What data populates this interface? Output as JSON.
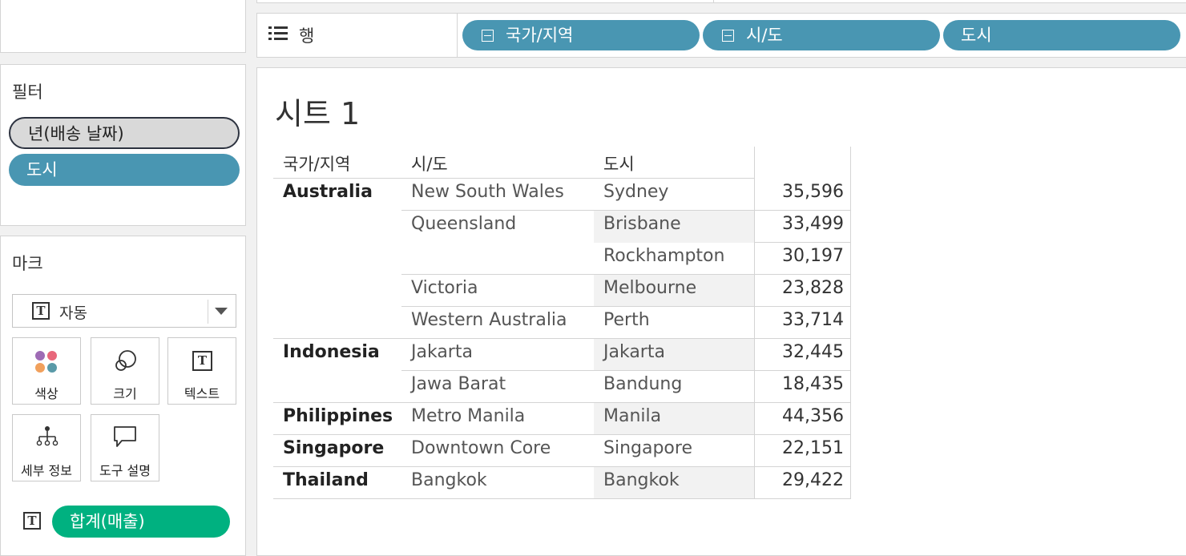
{
  "filters": {
    "title": "필터",
    "pills": [
      "년(배송 날짜)",
      "도시"
    ]
  },
  "marks": {
    "title": "마크",
    "type": "자동",
    "buttons": {
      "color": "색상",
      "size": "크기",
      "text": "텍스트",
      "detail": "세부 정보",
      "tooltip": "도구 설명"
    },
    "measure_pill": "합계(매출)"
  },
  "rows_shelf": {
    "label": "행",
    "pills": [
      "국가/지역",
      "시/도",
      "도시"
    ]
  },
  "sheet": {
    "title": "시트 1",
    "headers": [
      "국가/지역",
      "시/도",
      "도시"
    ],
    "rows": [
      {
        "country": "Australia",
        "state": "New South Wales",
        "city": "Sydney",
        "value": "35,596"
      },
      {
        "country": "",
        "state": "Queensland",
        "city": "Brisbane",
        "value": "33,499"
      },
      {
        "country": "",
        "state": "",
        "city": "Rockhampton",
        "value": "30,197"
      },
      {
        "country": "",
        "state": "Victoria",
        "city": "Melbourne",
        "value": "23,828"
      },
      {
        "country": "",
        "state": "Western Australia",
        "city": "Perth",
        "value": "33,714"
      },
      {
        "country": "Indonesia",
        "state": "Jakarta",
        "city": "Jakarta",
        "value": "32,445"
      },
      {
        "country": "",
        "state": "Jawa Barat",
        "city": "Bandung",
        "value": "18,435"
      },
      {
        "country": "Philippines",
        "state": "Metro Manila",
        "city": "Manila",
        "value": "44,356"
      },
      {
        "country": "Singapore",
        "state": "Downtown Core",
        "city": "Singapore",
        "value": "22,151"
      },
      {
        "country": "Thailand",
        "state": "Bangkok",
        "city": "Bangkok",
        "value": "29,422"
      }
    ]
  },
  "colors": {
    "dimension_pill": "#4996b2",
    "measure_pill": "#00b180",
    "filter_pill_grey": "#d9d9d9"
  }
}
